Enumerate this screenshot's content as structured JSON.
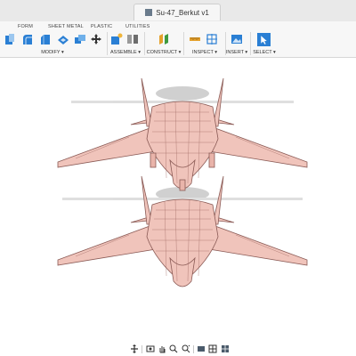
{
  "document": {
    "title": "Su-47_Berkut v1"
  },
  "ribbon": {
    "tabs": [
      "FORM",
      "SHEET METAL",
      "PLASTIC",
      "UTILITIES"
    ],
    "groups": {
      "modify": "MODIFY ▾",
      "assemble": "ASSEMBLE ▾",
      "construct": "CONSTRUCT ▾",
      "inspect": "INSPECT ▾",
      "insert": "INSERT ▾",
      "select": "SELECT ▾"
    }
  },
  "viewport": {
    "model_color": "#f0c4bb",
    "edge_color": "#8a5a55",
    "shadow_color": "#c8c8c8"
  },
  "colors": {
    "accent": "#1a6fc9",
    "icon_blue": "#2a7fd4"
  }
}
